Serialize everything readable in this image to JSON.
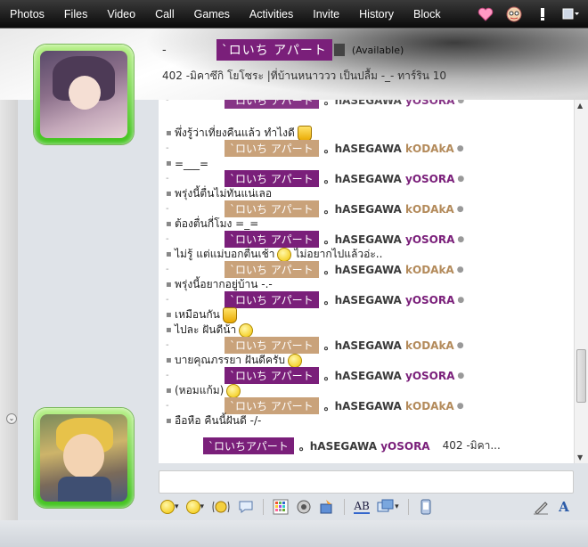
{
  "toolbar": {
    "menu": [
      "Photos",
      "Files",
      "Video",
      "Call",
      "Games",
      "Activities",
      "Invite",
      "History",
      "Block"
    ],
    "icons": [
      "heart-icon",
      "avatar-icon",
      "alert-icon",
      "menu-icon"
    ]
  },
  "contact": {
    "dash": "-",
    "name": "`ロいち アパート",
    "status": "(Available)",
    "personal_message": "402 -มิคาซึกิ โยโซระ |ที่บ้านหนาววว เป็นปลื้ม -_- ทาร์ริน 10"
  },
  "sender_names": {
    "a_chip": "`ロいち アパート",
    "a_rest_pre": "。hASEGAWA ",
    "a_rest_accent": "yOSORA",
    "b_chip": "`ロいち アパート",
    "b_rest_pre": "。hASEGAWA ",
    "b_rest_accent": "kODAkA"
  },
  "messages": [
    {
      "kind": "header-partial",
      "chip": "`ロいち アパート",
      "rest_pre": "。hASEGAWA ",
      "rest_accent": "yOSORA",
      "accent": "purple"
    },
    {
      "kind": "msg",
      "text": "พึ่งรู้ว่าเที่ยงคืนแล้ว ทำไงดี",
      "emo": "cup"
    },
    {
      "kind": "header",
      "chip": "`ロいち アパート",
      "rest_pre": "。hASEGAWA ",
      "rest_accent": "kODAkA",
      "chip_color": "tan",
      "accent": "tan"
    },
    {
      "kind": "msg",
      "text": "=___="
    },
    {
      "kind": "header",
      "chip": "`ロいち アパート",
      "rest_pre": "。hASEGAWA ",
      "rest_accent": "yOSORA",
      "chip_color": "purple",
      "accent": "purple"
    },
    {
      "kind": "msg",
      "text": "พรุ่งนี้ตื่นไม่ทันแน่เลอ"
    },
    {
      "kind": "header",
      "chip": "`ロいち アパート",
      "rest_pre": "。hASEGAWA ",
      "rest_accent": "kODAkA",
      "chip_color": "tan",
      "accent": "tan"
    },
    {
      "kind": "msg",
      "text": "ต้องตื่นกี่โมง =_="
    },
    {
      "kind": "header",
      "chip": "`ロいち アパート",
      "rest_pre": "。hASEGAWA ",
      "rest_accent": "yOSORA",
      "chip_color": "purple",
      "accent": "purple"
    },
    {
      "kind": "msg",
      "text": "ไม่รู้ แต่แม่บอกตื่นเช้า",
      "emo": "face",
      "text2": "ไม่อยากไปแล้วอ่ะ.."
    },
    {
      "kind": "header",
      "chip": "`ロいち アパート",
      "rest_pre": "。hASEGAWA ",
      "rest_accent": "kODAkA",
      "chip_color": "tan",
      "accent": "tan"
    },
    {
      "kind": "msg",
      "text": "พรุ่งนี้อยากอยู่บ้าน -.-"
    },
    {
      "kind": "header",
      "chip": "`ロいち アパート",
      "rest_pre": "。hASEGAWA ",
      "rest_accent": "yOSORA",
      "chip_color": "purple",
      "accent": "purple"
    },
    {
      "kind": "msg",
      "text": "เหมือนกัน",
      "emo": "cup"
    },
    {
      "kind": "msg",
      "text": "ไปละ ฝันดีน้า",
      "emo": "face"
    },
    {
      "kind": "header",
      "chip": "`ロいち アパート",
      "rest_pre": "。hASEGAWA ",
      "rest_accent": "kODAkA",
      "chip_color": "tan",
      "accent": "tan"
    },
    {
      "kind": "msg",
      "text": "บายคุณภรรยา ฝันดีครับ",
      "emo": "face"
    },
    {
      "kind": "header",
      "chip": "`ロいち アパート",
      "rest_pre": "。hASEGAWA ",
      "rest_accent": "yOSORA",
      "chip_color": "purple",
      "accent": "purple"
    },
    {
      "kind": "msg",
      "text": "(หอมแก้ม)",
      "emo": "face"
    },
    {
      "kind": "header",
      "chip": "`ロいち アパート",
      "rest_pre": "。hASEGAWA ",
      "rest_accent": "kODAkA",
      "chip_color": "tan",
      "accent": "tan"
    },
    {
      "kind": "msg",
      "text": "อือหือ คืนนี้ฝันดี -/-"
    }
  ],
  "self_line": {
    "chip": "`ロいちアパート",
    "rest_pre": "。hASEGAWA ",
    "rest_accent": "yOSORA",
    "suffix": "402 -มิคา..."
  },
  "colors": {
    "purple": "#7a1f7a",
    "tan": "#c9a27a",
    "frame_green": "#3ec21b"
  },
  "input": {
    "value": ""
  },
  "bottom_toolbar": {
    "icons": [
      "emoticon-icon",
      "wink-icon",
      "nudge-icon",
      "voice-clip-icon",
      "background-icon",
      "game-icon",
      "file-share-icon",
      "font-icon",
      "color-icon",
      "send-file-icon",
      "handwriting-icon",
      "text-format-icon"
    ]
  }
}
